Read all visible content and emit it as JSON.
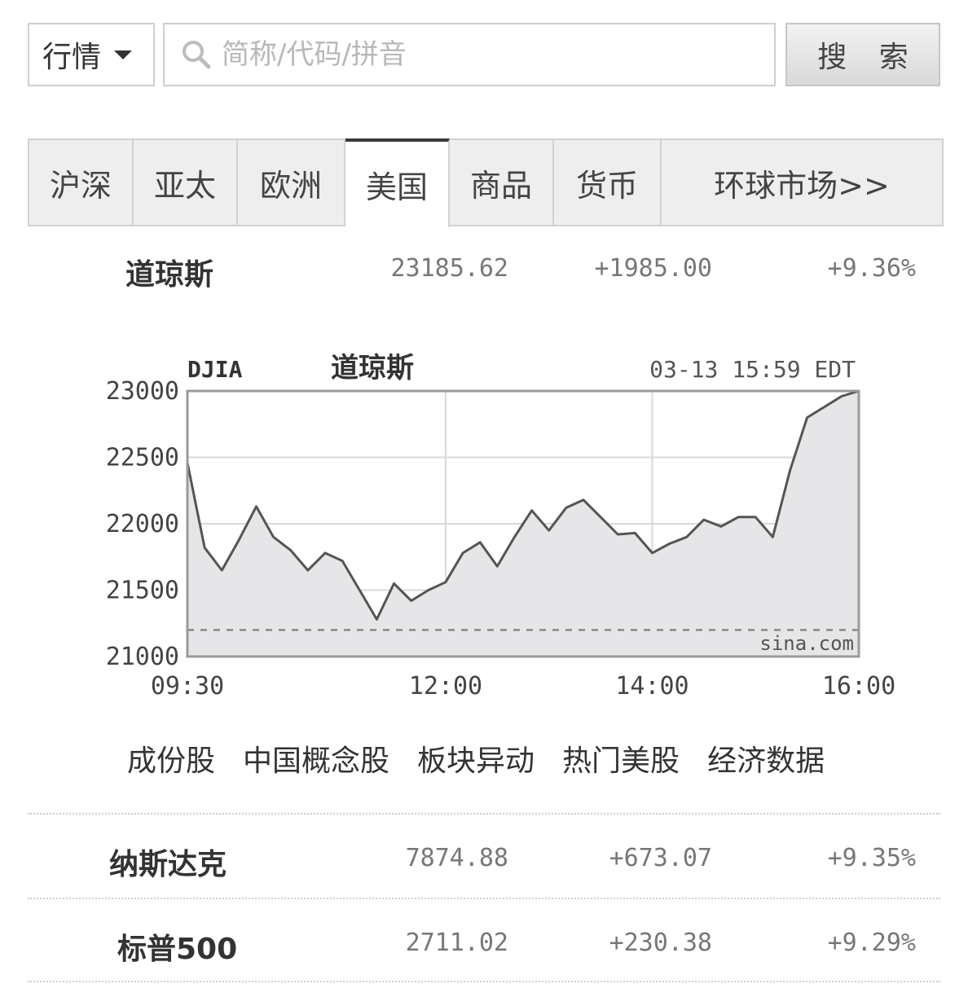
{
  "search": {
    "type_label": "行情",
    "placeholder": "简称/代码/拼音",
    "button_label": "搜 索"
  },
  "tabs": [
    {
      "label": "沪深",
      "active": false
    },
    {
      "label": "亚太",
      "active": false
    },
    {
      "label": "欧洲",
      "active": false
    },
    {
      "label": "美国",
      "active": true
    },
    {
      "label": "商品",
      "active": false
    },
    {
      "label": "货币",
      "active": false
    },
    {
      "label": "环球市场>>",
      "active": false
    }
  ],
  "indices": [
    {
      "name": "道琼斯",
      "price": "23185.62",
      "change": "+1985.00",
      "pct": "+9.36%"
    },
    {
      "name": "纳斯达克",
      "price": "7874.88",
      "change": "+673.07",
      "pct": "+9.35%"
    },
    {
      "name": "标普500",
      "price": "2711.02",
      "change": "+230.38",
      "pct": "+9.29%"
    }
  ],
  "subnav": [
    "成份股",
    "中国概念股",
    "板块异动",
    "热门美股",
    "经济数据"
  ],
  "colors": {
    "line": "#555555",
    "fill": "#e6e6e8",
    "grid": "#d8d8d8",
    "prev_close": "#888888"
  },
  "chart_data": {
    "type": "area",
    "symbol": "DJIA",
    "title": "道琼斯",
    "timestamp": "03-13 15:59 EDT",
    "watermark": "sina.com",
    "yticks": [
      "23000",
      "22500",
      "22000",
      "21500",
      "21000"
    ],
    "xticks": [
      "09:30",
      "12:00",
      "14:00",
      "16:00"
    ],
    "ylim": [
      21000,
      23000
    ],
    "prev_close": 21200,
    "x": [
      "09:30",
      "09:40",
      "09:50",
      "10:00",
      "10:10",
      "10:20",
      "10:30",
      "10:40",
      "10:50",
      "11:00",
      "11:10",
      "11:20",
      "11:30",
      "11:40",
      "11:50",
      "12:00",
      "12:10",
      "12:20",
      "12:30",
      "12:40",
      "12:50",
      "13:00",
      "13:10",
      "13:20",
      "13:30",
      "13:40",
      "13:50",
      "14:00",
      "14:10",
      "14:20",
      "14:30",
      "14:40",
      "14:50",
      "15:00",
      "15:10",
      "15:20",
      "15:30",
      "15:40",
      "15:50",
      "16:00"
    ],
    "series": [
      {
        "values": [
          22460,
          21820,
          21650,
          21880,
          22130,
          21900,
          21800,
          21650,
          21780,
          21720,
          21500,
          21280,
          21550,
          21420,
          21500,
          21560,
          21780,
          21860,
          21680,
          21900,
          22100,
          21950,
          22120,
          22180,
          22050,
          21920,
          21930,
          21780,
          21850,
          21900,
          22030,
          21980,
          22050,
          22050,
          21900,
          22400,
          22800,
          22880,
          22960,
          23000
        ]
      }
    ]
  }
}
